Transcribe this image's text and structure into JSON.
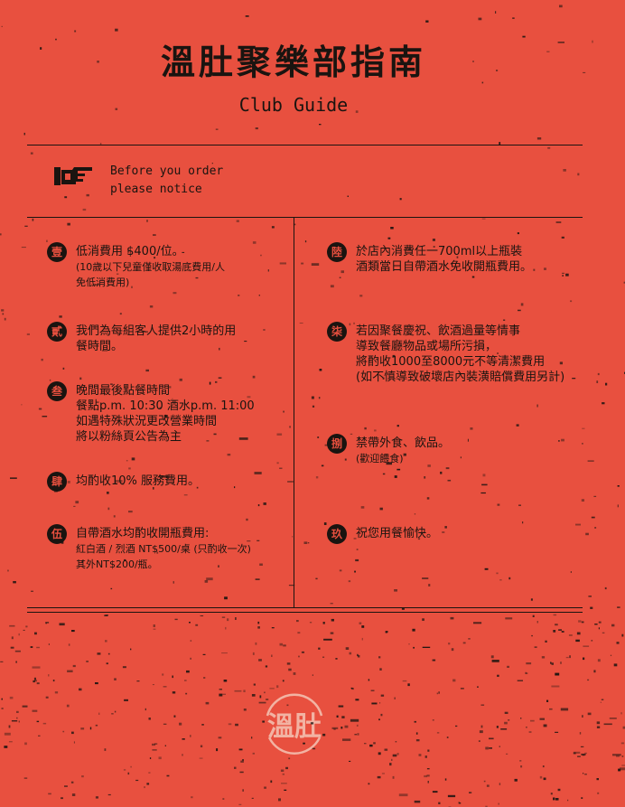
{
  "header": {
    "title": "溫肚聚樂部指南",
    "subtitle": "Club Guide"
  },
  "notice": {
    "icon": "pointing-hand-icon",
    "line1": "Before you order",
    "line2": "please notice"
  },
  "left_items": [
    {
      "numeral": "壹",
      "main": [
        "低消費用 $400/位。"
      ],
      "notes": [
        "(10歲以下兒童僅收取湯底費用/人",
        "免低消費用)"
      ]
    },
    {
      "numeral": "貳",
      "main": [
        "我們為每組客人提供2小時的用",
        "餐時間。"
      ],
      "notes": []
    },
    {
      "numeral": "叁",
      "main": [
        "晚間最後點餐時間",
        "餐點p.m. 10:30  酒水p.m. 11:00",
        "如遇特殊狀況更改營業時間",
        "將以粉絲頁公告為主"
      ],
      "notes": []
    },
    {
      "numeral": "肆",
      "main": [
        "均酌收10% 服務費用。"
      ],
      "notes": []
    },
    {
      "numeral": "伍",
      "main": [
        "自帶酒水均酌收開瓶費用:"
      ],
      "notes": [
        "紅白酒 / 烈酒 NT$500/桌 (只酌收一次)",
        "其外NT$200/瓶。"
      ]
    }
  ],
  "right_items": [
    {
      "numeral": "陸",
      "main": [
        "於店內消費任一700ml以上瓶裝",
        "酒類當日自帶酒水免收開瓶費用。"
      ],
      "notes": []
    },
    {
      "numeral": "柒",
      "main": [
        "若因聚餐慶祝、飲酒過量等情事",
        "導致餐廳物品或場所污損，",
        "將酌收1000至8000元不等清潔費用",
        "(如不慎導致破壞店內裝潢賠償費用另計)"
      ],
      "notes": []
    },
    {
      "numeral": "捌",
      "main": [
        "禁帶外食、飲品。"
      ],
      "notes": [
        "(歡迎餵食)"
      ]
    },
    {
      "numeral": "玖",
      "main": [
        "祝您用餐愉快。"
      ],
      "notes": []
    }
  ],
  "logo": {
    "main": "溫肚",
    "top_arc": "嘿如果首來",
    "bottom_arc": "溫肚來聞滿"
  },
  "colors": {
    "background": "#e8503f",
    "ink": "#1a1410"
  }
}
